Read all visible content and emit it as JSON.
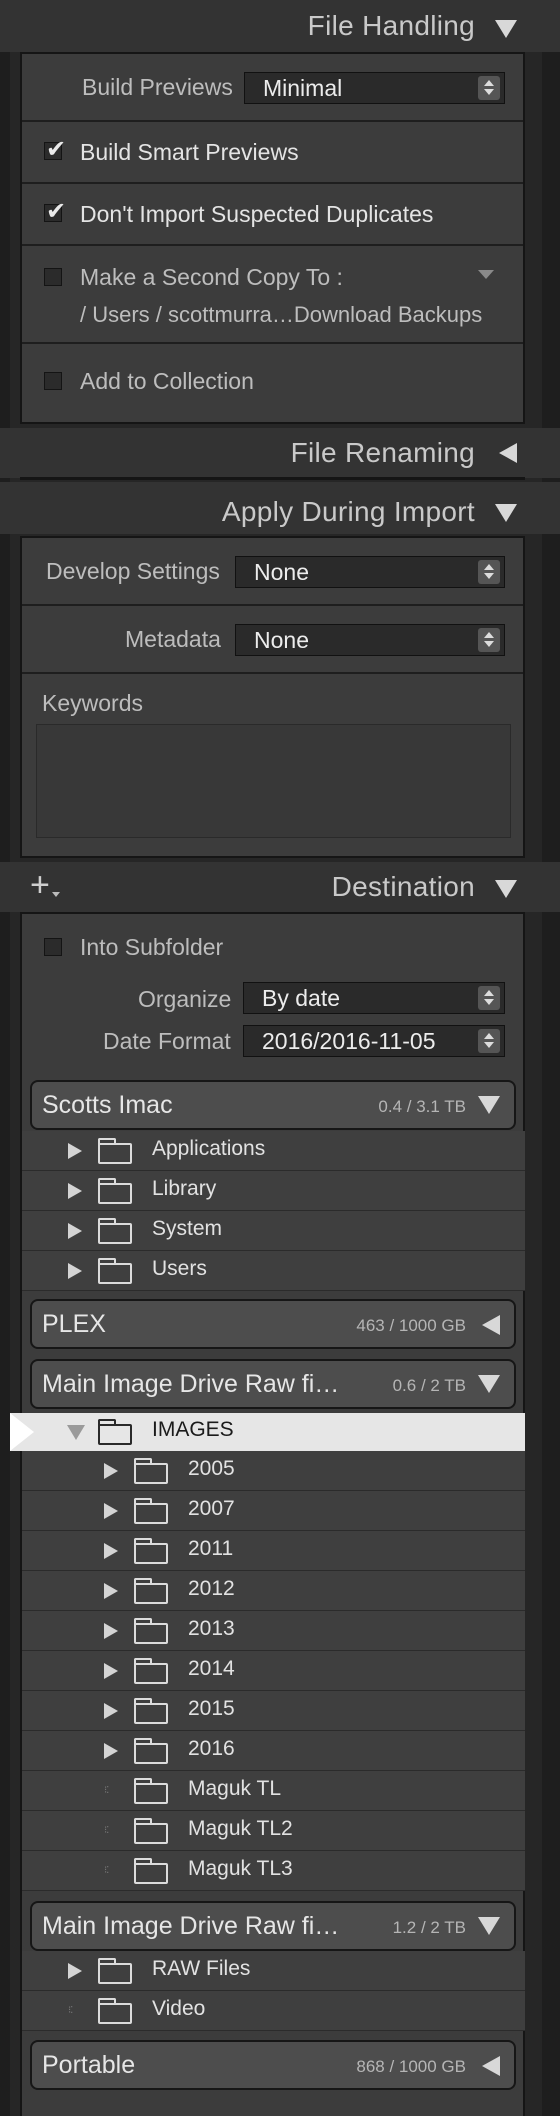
{
  "file_handling": {
    "title": "File Handling",
    "build_previews_label": "Build Previews",
    "build_previews_value": "Minimal",
    "build_smart_previews_label": "Build Smart Previews",
    "build_smart_previews_checked": true,
    "dont_import_duplicates_label": "Don't Import Suspected Duplicates",
    "dont_import_duplicates_checked": true,
    "second_copy_label": "Make a Second Copy To :",
    "second_copy_path": "/ Users / scottmurra…Download Backups",
    "second_copy_checked": false,
    "add_collection_label": "Add to Collection",
    "add_collection_checked": false
  },
  "file_renaming": {
    "title": "File Renaming"
  },
  "apply_during_import": {
    "title": "Apply During Import",
    "develop_settings_label": "Develop Settings",
    "develop_settings_value": "None",
    "metadata_label": "Metadata",
    "metadata_value": "None",
    "keywords_label": "Keywords",
    "keywords_value": ""
  },
  "destination": {
    "title": "Destination",
    "add_button_glyph": "+",
    "into_subfolder_label": "Into Subfolder",
    "into_subfolder_checked": false,
    "organize_label": "Organize",
    "organize_value": "By date",
    "date_format_label": "Date Format",
    "date_format_value": "2016/2016-11-05",
    "volumes": [
      {
        "name": "Scotts Imac",
        "size": "0.4 / 3.1 TB",
        "expanded": true,
        "folders": [
          "Applications",
          "Library",
          "System",
          "Users"
        ]
      },
      {
        "name": "PLEX",
        "size": "463 / 1000 GB",
        "expanded": false
      },
      {
        "name": "Main Image Drive Raw fi…",
        "size": "0.6 / 2 TB",
        "expanded": true,
        "selected_folder": "IMAGES",
        "subfolders": [
          "2005",
          "2007",
          "2011",
          "2012",
          "2013",
          "2014",
          "2015",
          "2016",
          "Maguk TL",
          "Maguk TL2",
          "Maguk TL3"
        ]
      },
      {
        "name": "Main Image Drive Raw fi…",
        "size": "1.2 / 2 TB",
        "expanded": true,
        "folders": [
          "RAW Files",
          "Video"
        ]
      },
      {
        "name": "Portable",
        "size": "868 / 1000 GB",
        "expanded": false
      }
    ]
  },
  "icons": {
    "expand": "triangle-down-icon",
    "collapse": "triangle-left-icon",
    "folder": "folder-icon",
    "disclosure": "triangle-right-icon"
  },
  "colors": {
    "panel_bg": "#3c3c3c",
    "header_bg": "#333333",
    "selected_row_bg": "#e6e6e6",
    "text": "#e2e2e2"
  }
}
